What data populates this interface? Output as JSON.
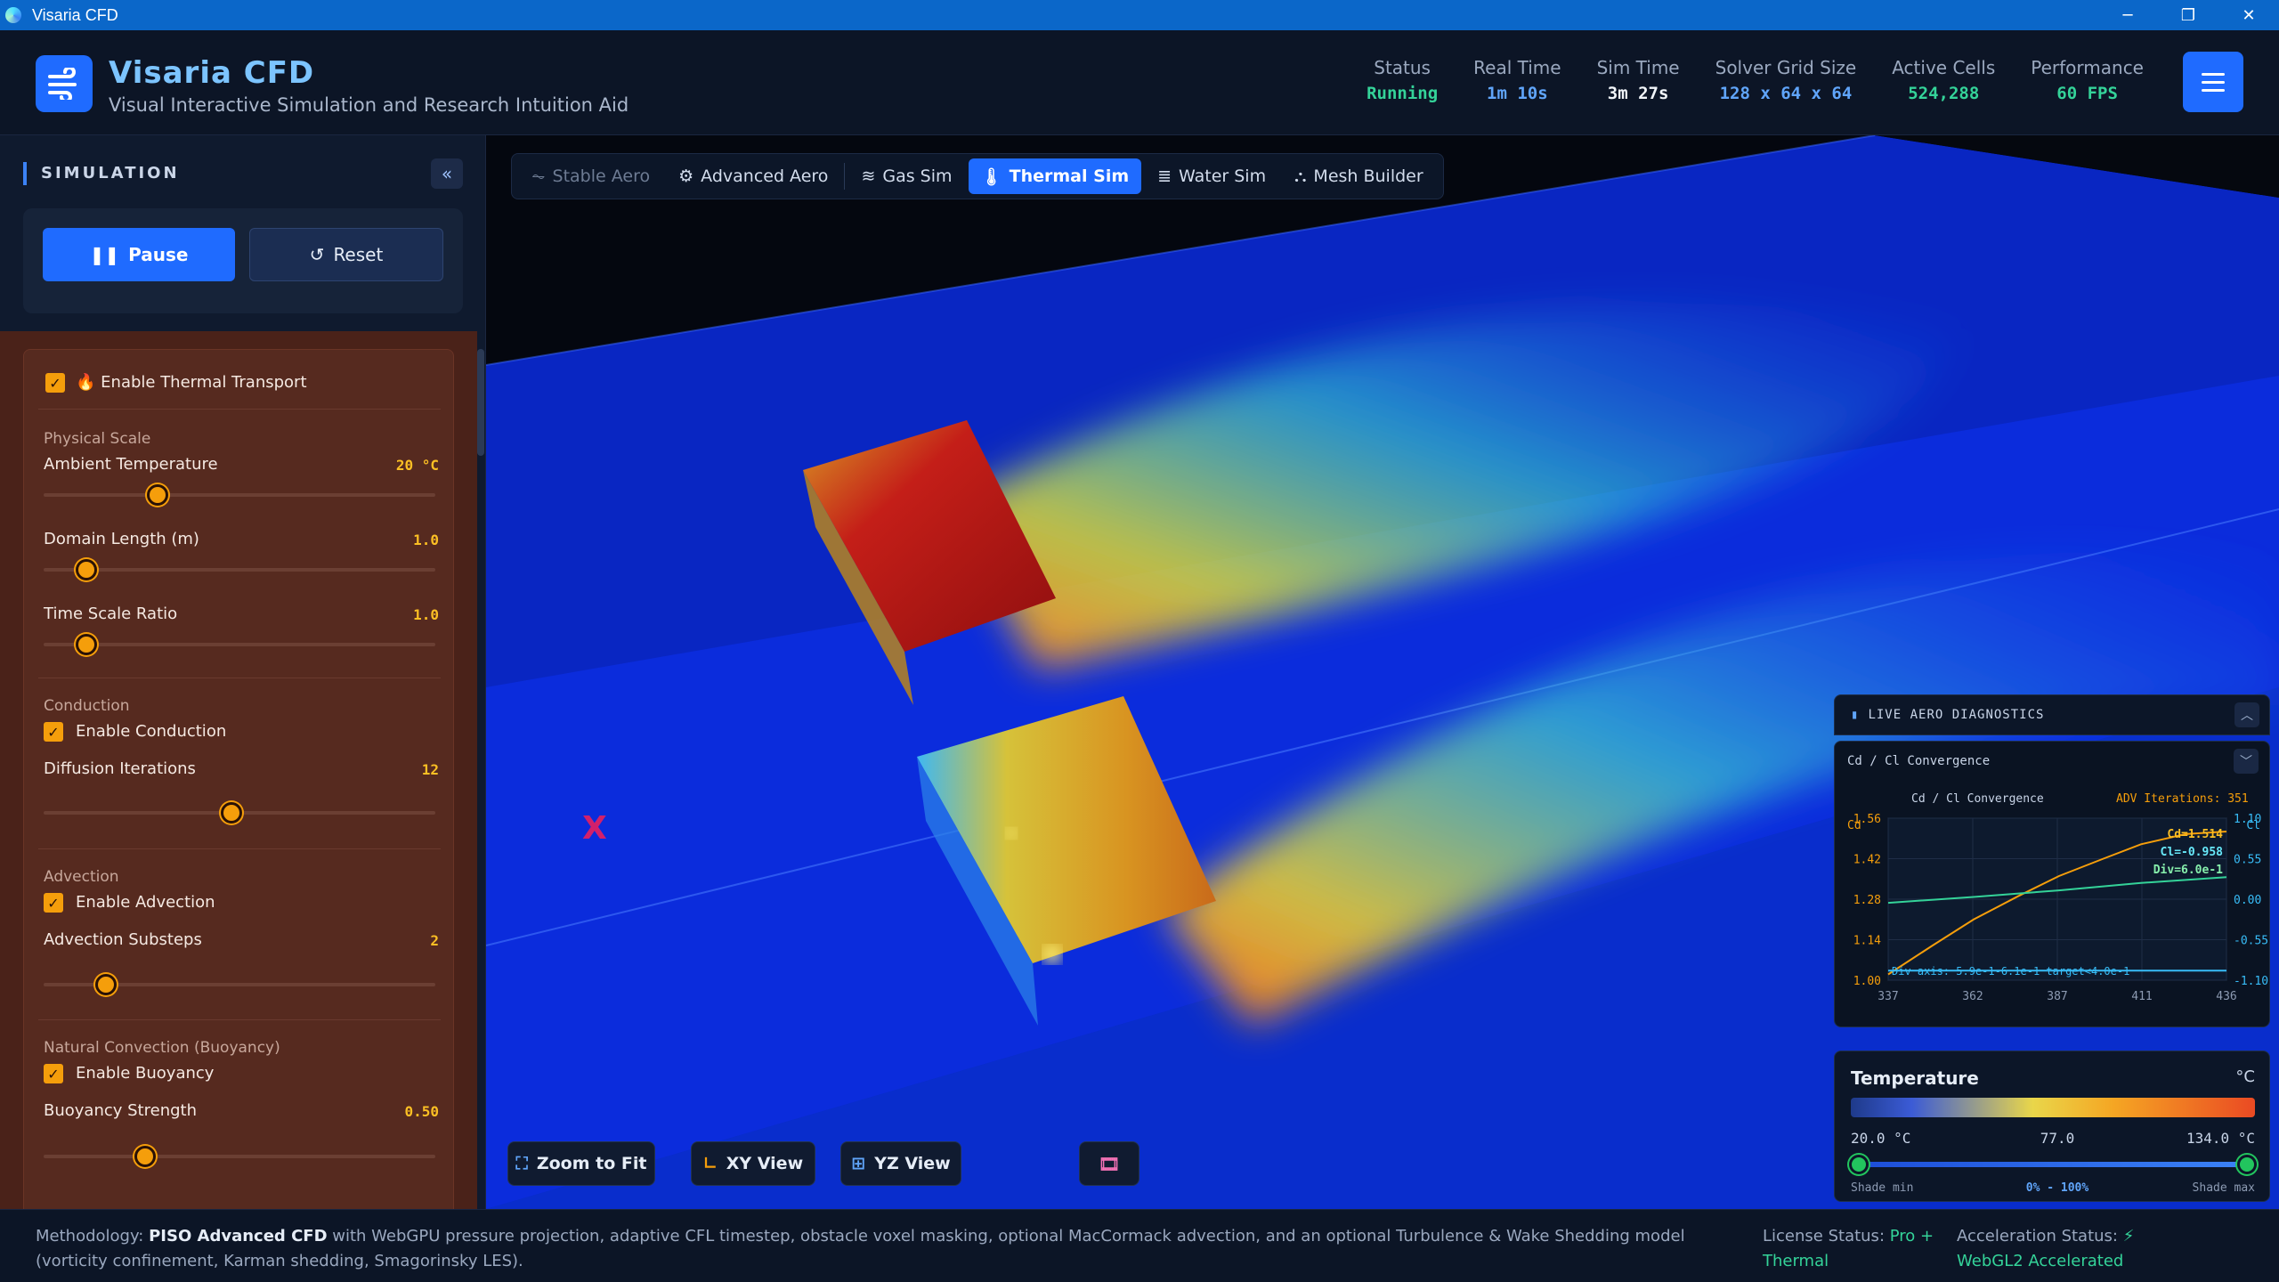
{
  "window": {
    "title": "Visaria CFD"
  },
  "header": {
    "brand": "Visaria CFD",
    "tagline": "Visual Interactive Simulation and Research Intuition Aid",
    "stats": [
      {
        "label": "Status",
        "value": "Running",
        "color": "#34d399"
      },
      {
        "label": "Real Time",
        "value": "1m 10s",
        "color": "#60a5fa"
      },
      {
        "label": "Sim Time",
        "value": "3m 27s",
        "color": "#f1f5f9"
      },
      {
        "label": "Solver Grid Size",
        "value": "128 x 64 x 64",
        "color": "#60a5fa"
      },
      {
        "label": "Active Cells",
        "value": "524,288",
        "color": "#34d399"
      },
      {
        "label": "Performance",
        "value": "60 FPS",
        "color": "#34d399"
      }
    ]
  },
  "sidebar": {
    "section_title": "SIMULATION",
    "pause_label": "Pause",
    "reset_label": "Reset",
    "thermal": {
      "enable_label": "Enable Thermal Transport",
      "physical_scale": "Physical Scale",
      "ambient_label": "Ambient Temperature",
      "ambient_value": "20 °C",
      "ambient_pos": 0.29,
      "domain_label": "Domain Length (m)",
      "domain_value": "1.0",
      "domain_pos": 0.11,
      "timescale_label": "Time Scale Ratio",
      "timescale_value": "1.0",
      "timescale_pos": 0.11,
      "conduction": "Conduction",
      "enable_conduction": "Enable Conduction",
      "diffusion_label": "Diffusion Iterations",
      "diffusion_value": "12",
      "diffusion_pos": 0.48,
      "advection": "Advection",
      "enable_advection": "Enable Advection",
      "substeps_label": "Advection Substeps",
      "substeps_value": "2",
      "substeps_pos": 0.16,
      "convection": "Natural Convection (Buoyancy)",
      "enable_buoyancy": "Enable Buoyancy",
      "buoyancy_label": "Buoyancy Strength",
      "buoyancy_value": "0.50",
      "buoyancy_pos": 0.26
    }
  },
  "tabs": [
    {
      "label": "Stable Aero",
      "icon": "waveform-icon",
      "state": "dim"
    },
    {
      "label": "Advanced Aero",
      "icon": "gear-icon",
      "state": "normal"
    },
    {
      "label": "Gas Sim",
      "icon": "wind-icon",
      "state": "normal"
    },
    {
      "label": "Thermal Sim",
      "icon": "thermometer-icon",
      "state": "active"
    },
    {
      "label": "Water Sim",
      "icon": "water-icon",
      "state": "normal"
    },
    {
      "label": "Mesh Builder",
      "icon": "mesh-icon",
      "state": "normal"
    }
  ],
  "view_controls": {
    "zoom_fit": "Zoom to Fit",
    "xy_view": "XY View",
    "yz_view": "YZ View"
  },
  "axis_label": "X",
  "diagnostics": {
    "title": "LIVE AERO DIAGNOSTICS",
    "chart_section": "Cd / Cl Convergence",
    "chart_title": "Cd / Cl Convergence",
    "iterations_label": "ADV Iterations: 351",
    "readout_cd": "Cd=1.514",
    "readout_cl": "Cl=-0.958",
    "readout_div": "Div=6.0e-1",
    "baseline_note": "Div axis: 5.9e-1-6.1e-1  target<4.0e-1",
    "left_axis_label": "Cd",
    "right_axis_label": "Cl"
  },
  "chart_data": {
    "type": "line",
    "x_ticks": [
      "337",
      "362",
      "387",
      "411",
      "436"
    ],
    "xlim": [
      337,
      436
    ],
    "y_left_ticks": [
      "1.56",
      "1.42",
      "1.28",
      "1.14",
      "1.00"
    ],
    "ylim_left": [
      1.0,
      1.56
    ],
    "y_right_ticks": [
      "1.10",
      "0.55",
      "0.00",
      "-0.55",
      "-1.10"
    ],
    "ylim_right": [
      -1.1,
      1.1
    ],
    "series": [
      {
        "name": "Cd",
        "axis": "left",
        "color": "#f59e0b",
        "x": [
          337,
          350,
          362,
          375,
          387,
          400,
          411,
          424,
          436
        ],
        "y": [
          1.02,
          1.12,
          1.21,
          1.29,
          1.36,
          1.42,
          1.47,
          1.505,
          1.514
        ]
      },
      {
        "name": "Cl",
        "axis": "right",
        "color": "#34d399",
        "x": [
          337,
          362,
          387,
          411,
          436
        ],
        "y": [
          -0.05,
          0.03,
          0.12,
          0.22,
          0.3
        ]
      },
      {
        "name": "Div",
        "axis": "right",
        "color": "#38bdf8",
        "x": [
          337,
          362,
          387,
          411,
          436
        ],
        "y": [
          -0.97,
          -0.97,
          -0.97,
          -0.97,
          -0.97
        ]
      }
    ]
  },
  "legend": {
    "title": "Temperature",
    "unit": "°C",
    "min": "20.0 °C",
    "mid": "77.0",
    "max": "134.0 °C",
    "shade_min": "Shade min",
    "shade_max": "Shade max",
    "range": "0% - 100%"
  },
  "footer": {
    "methodology_label": "Methodology:",
    "methodology_name": "PISO Advanced CFD",
    "methodology_text": " with WebGPU pressure projection, adaptive CFL timestep, obstacle voxel masking, optional MacCormack advection, and an optional Turbulence & Wake Shedding model (vorticity confinement, Karman shedding, Smagorinsky LES).",
    "license_label": "License Status:",
    "license_value": "Pro + Thermal",
    "accel_label": "Acceleration Status:",
    "accel_value": "⚡ WebGL2 Accelerated"
  }
}
